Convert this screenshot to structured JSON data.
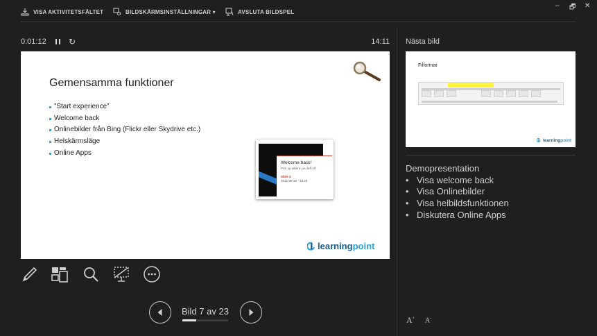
{
  "toolbar": {
    "taskbar_label": "VISA AKTIVITETSFÄLTET",
    "display_settings_label": "BILDSKÄRMSINSTÄLLNINGAR ▾",
    "end_show_label": "AVSLUTA BILDSPEL"
  },
  "window": {
    "minimize": "–",
    "restore": "🗗",
    "close": "✕"
  },
  "timer": {
    "elapsed": "0:01:12",
    "clock": "14:11"
  },
  "current_slide": {
    "title": "Gemensamma funktioner",
    "bullets": [
      "”Start experience”",
      "Welcome back",
      "Onlinebilder från Bing (Flickr eller Skydrive etc.)",
      "Helskärmsläge",
      "Online Apps"
    ],
    "welcome_card": {
      "title": "Welcome back!",
      "subtitle": "Pick up where you left off:",
      "slide_ref": "Slide 3",
      "timestamp": "2012-09-16 - 18:46"
    },
    "logo": {
      "part1": "learning",
      "part2": "point"
    }
  },
  "tools": [
    "pen-tool-icon",
    "see-all-slides-icon",
    "zoom-icon",
    "black-screen-icon",
    "more-options-icon"
  ],
  "navigation": {
    "counter": "Bild 7 av 23",
    "current": 7,
    "total": 23,
    "progress": 0.3
  },
  "next_slide": {
    "label": "Nästa bild",
    "title": "Filformat",
    "logo": {
      "part1": "learning",
      "part2": "point"
    }
  },
  "notes": {
    "heading": "Demopresentation",
    "items": [
      "Visa welcome back",
      "Visa Onlinebilder",
      "Visa helbildsfunktionen",
      "Diskutera Online Apps"
    ]
  },
  "font_controls": {
    "increase": "A",
    "decrease": "A"
  },
  "colors": {
    "background": "#1f1f1f",
    "accent": "#2da1d8",
    "text": "#d0d0d0"
  }
}
